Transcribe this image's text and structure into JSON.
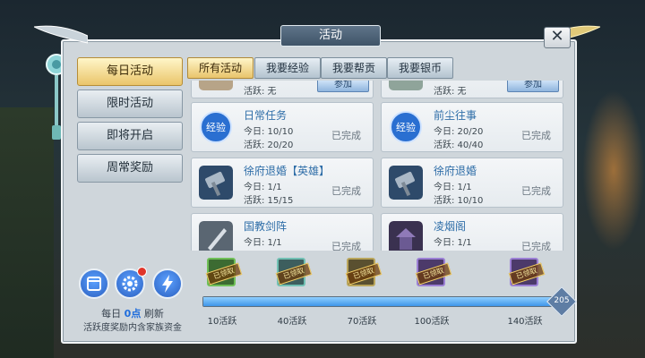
{
  "window": {
    "title": "活动",
    "close_label": "✕"
  },
  "colors": {
    "accent_gold": "#e9c46c",
    "link_blue": "#2f6ea8",
    "progress_blue": "#3f95e8",
    "notify_red": "#e0362a"
  },
  "sidebar": {
    "items": [
      {
        "label": "每日活动",
        "active": true
      },
      {
        "label": "限时活动",
        "active": false
      },
      {
        "label": "即将开启",
        "active": false
      },
      {
        "label": "周常奖励",
        "active": false
      }
    ]
  },
  "tabs": [
    {
      "label": "所有活动",
      "active": true
    },
    {
      "label": "我要经验",
      "active": false
    },
    {
      "label": "我要帮贡",
      "active": false
    },
    {
      "label": "我要银币",
      "active": false
    }
  ],
  "activities": [
    {
      "name": "",
      "today": "",
      "active": "活跃: 无",
      "status": "",
      "button": "参加",
      "icon": "generic-activity-icon"
    },
    {
      "name": "",
      "today": "",
      "active": "活跃: 无",
      "status": "",
      "button": "参加",
      "icon": "generic-activity-icon"
    },
    {
      "name": "日常任务",
      "today": "今日: 10/10",
      "active": "活跃: 20/20",
      "status": "已完成",
      "button": "",
      "icon": "exp-orb-icon",
      "icon_text": "经验"
    },
    {
      "name": "前尘往事",
      "today": "今日: 20/20",
      "active": "活跃: 40/40",
      "status": "已完成",
      "button": "",
      "icon": "exp-orb-icon",
      "icon_text": "经验"
    },
    {
      "name": "徐府退婚【英雄】",
      "today": "今日: 1/1",
      "active": "活跃: 15/15",
      "status": "已完成",
      "button": "",
      "icon": "hammer-icon"
    },
    {
      "name": "徐府退婚",
      "today": "今日: 1/1",
      "active": "活跃: 10/10",
      "status": "已完成",
      "button": "",
      "icon": "hammer-icon"
    },
    {
      "name": "国教剑阵",
      "today": "今日: 1/1",
      "active": "",
      "status": "已完成",
      "button": "",
      "icon": "sword-array-icon"
    },
    {
      "name": "凌烟阁",
      "today": "今日: 1/1",
      "active": "",
      "status": "已完成",
      "button": "",
      "icon": "pavilion-icon"
    }
  ],
  "bottom_panel": {
    "icons": [
      "calendar-icon",
      "settings-gear-icon",
      "lightning-icon"
    ],
    "refresh": {
      "prefix": "每日",
      "time": "0点",
      "suffix": "刷新"
    },
    "fund_note": "活跃度奖励内含家族资金"
  },
  "progress": {
    "current": 205,
    "max_label": "205",
    "milestones": [
      {
        "label": "10活跃",
        "value": 10,
        "claimed_text": "已领取"
      },
      {
        "label": "40活跃",
        "value": 40,
        "claimed_text": "已领取"
      },
      {
        "label": "70活跃",
        "value": 70,
        "claimed_text": "已领取"
      },
      {
        "label": "100活跃",
        "value": 100,
        "claimed_text": "已领取"
      },
      {
        "label": "140活跃",
        "value": 140,
        "claimed_text": "已领取"
      }
    ]
  }
}
